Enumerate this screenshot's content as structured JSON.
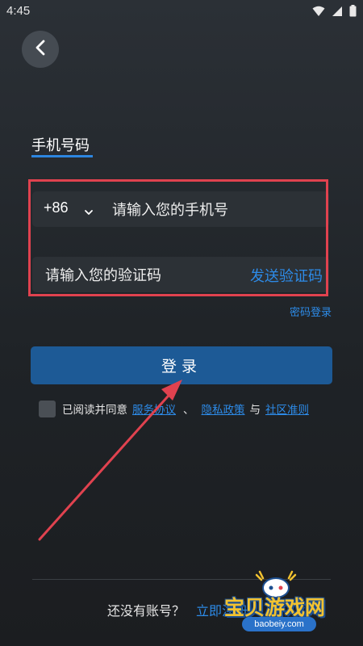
{
  "status_bar": {
    "time": "4:45",
    "icons": [
      "wifi-icon",
      "signal-icon",
      "battery-icon"
    ]
  },
  "header": {
    "back_icon": "chevron-left-icon"
  },
  "tab": {
    "label": "手机号码",
    "accent_color": "#2d86e0"
  },
  "form": {
    "country_code": "+86",
    "phone_placeholder": "请输入您的手机号",
    "code_placeholder": "请输入您的验证码",
    "send_code_label": "发送验证码",
    "password_login_label": "密码登录",
    "highlight_color": "#e0424f"
  },
  "login_button": {
    "label": "登录",
    "color": "#1d5a96"
  },
  "agreement": {
    "prefix": "已阅读并同意",
    "service_link": "服务协议",
    "separator": "、",
    "privacy_link": "隐私政策",
    "and_text": "与",
    "community_link": "社区准则"
  },
  "footer": {
    "no_account_text": "还没有账号？",
    "register_link": "立即注册"
  },
  "watermark": {
    "brand": "宝贝游戏网",
    "url": "baobeiy.com"
  },
  "link_color": "#2d8be8"
}
